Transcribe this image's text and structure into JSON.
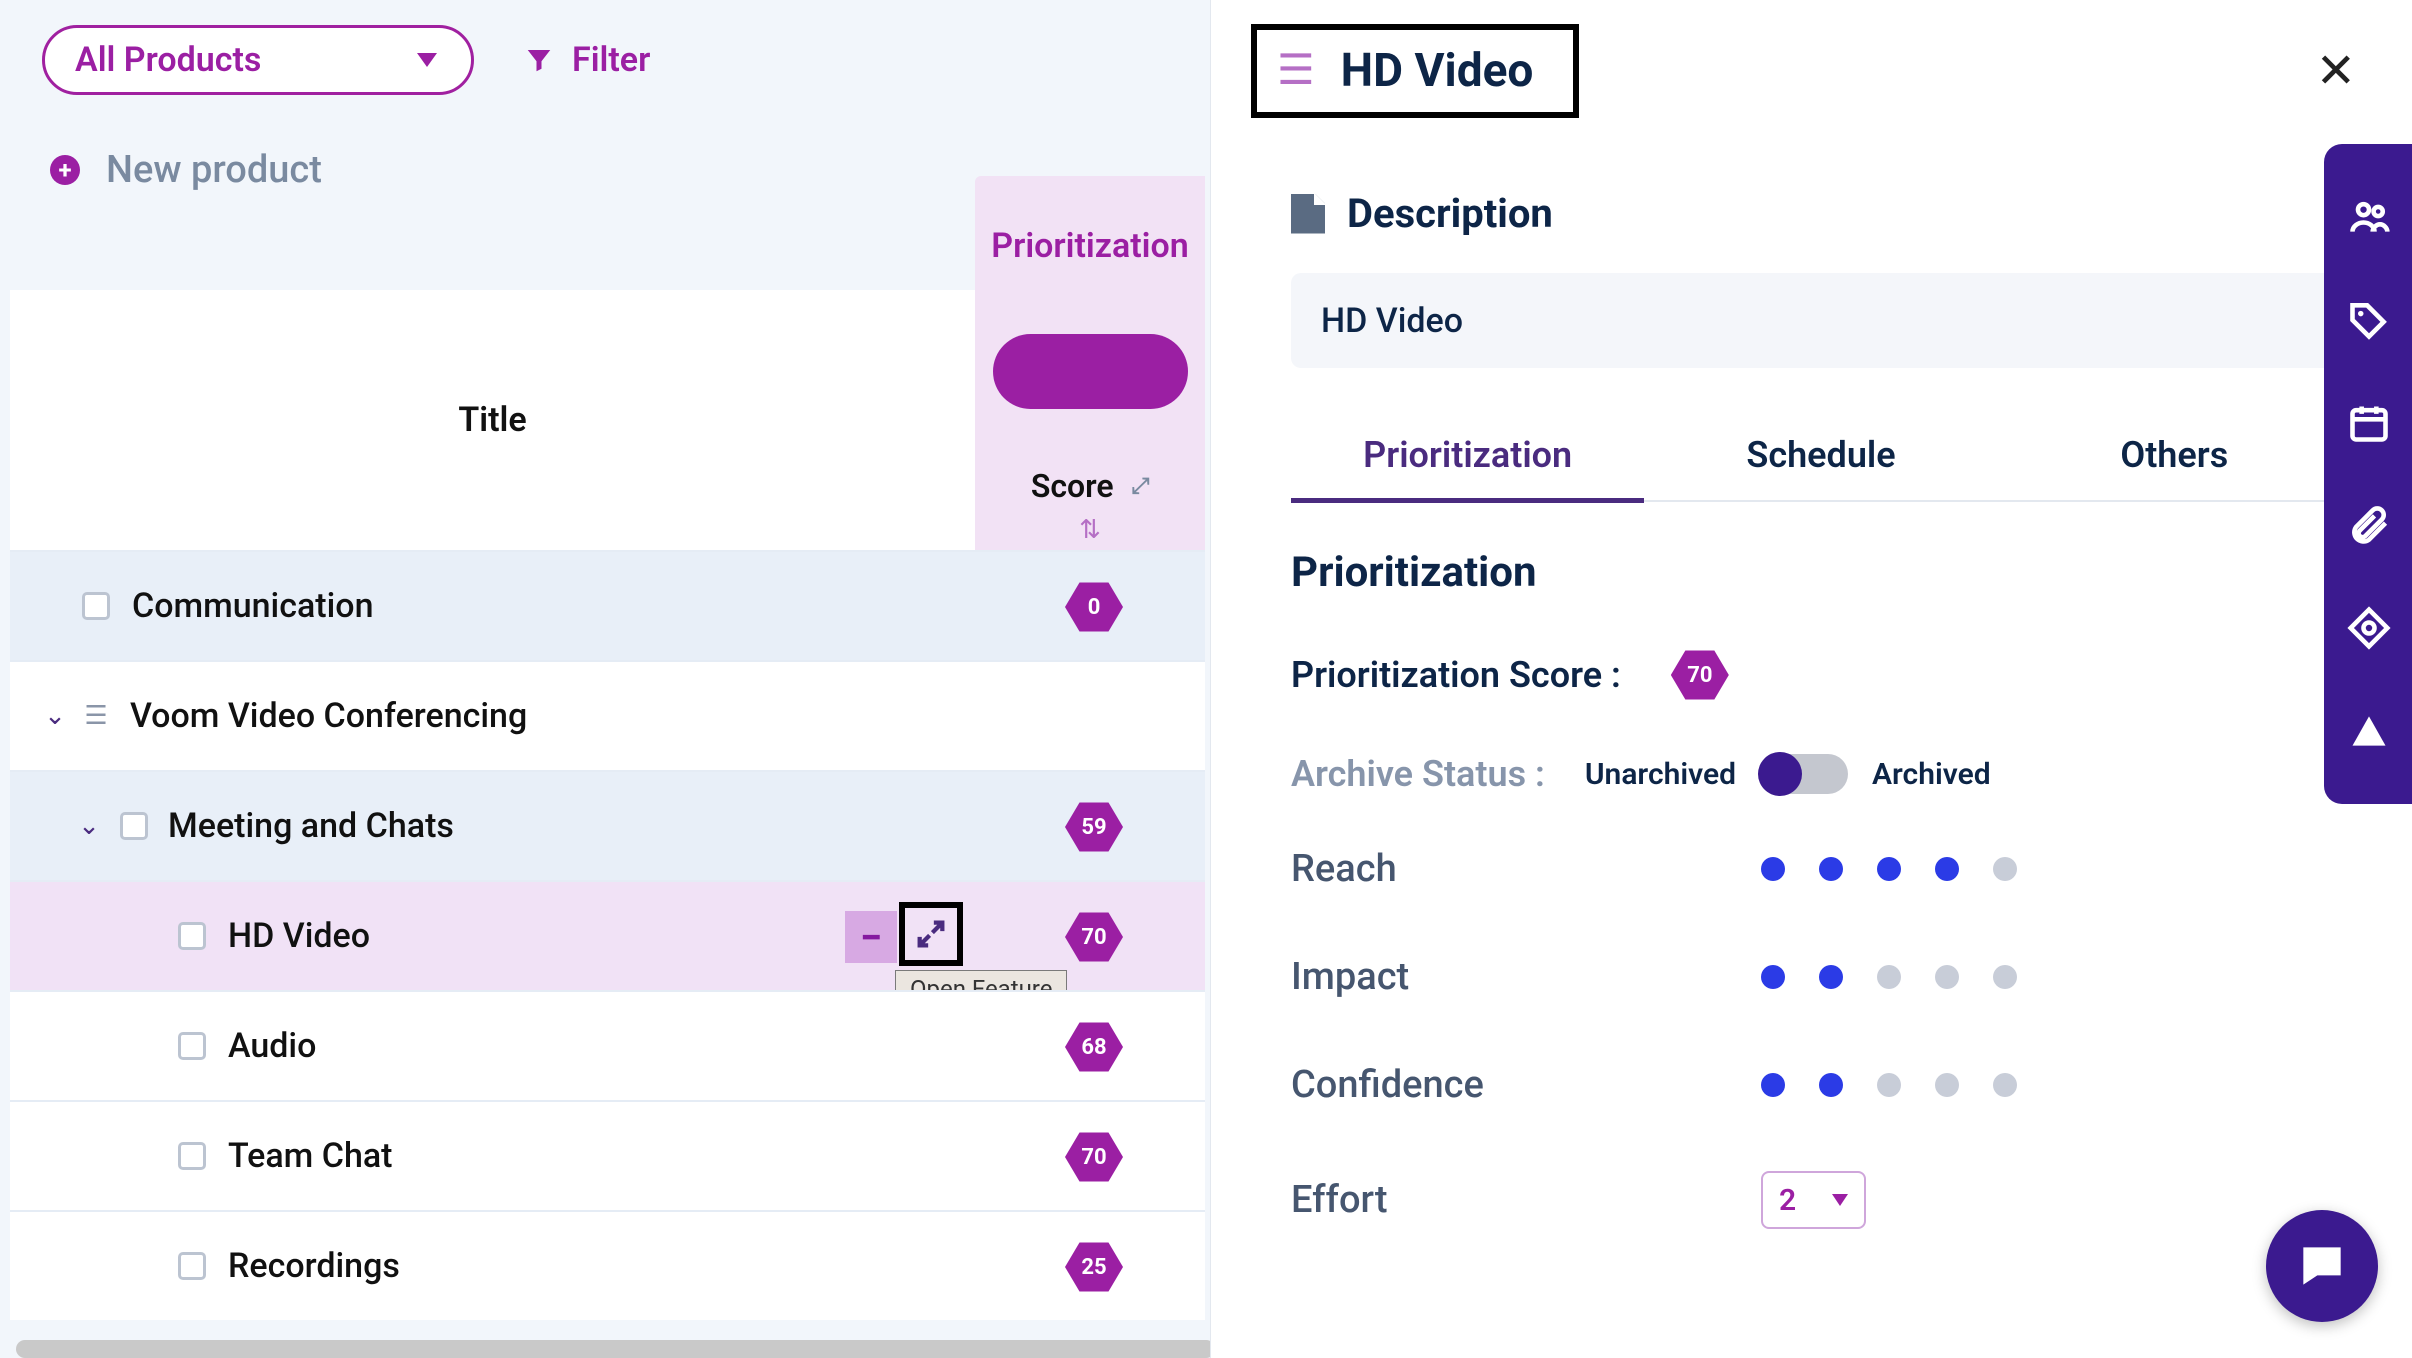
{
  "toolbar": {
    "products_dropdown_label": "All Products",
    "filter_label": "Filter"
  },
  "new_product_label": "New product",
  "columns": {
    "title": "Title",
    "prioritization_tab": "Prioritization",
    "score": "Score"
  },
  "rows": [
    {
      "type": "product",
      "title": "Communication",
      "score": "0"
    },
    {
      "type": "group",
      "title": "Voom Video Conferencing"
    },
    {
      "type": "subgroup",
      "title": "Meeting and Chats",
      "score": "59"
    },
    {
      "type": "feature",
      "title": "HD Video",
      "score": "70",
      "selected": true
    },
    {
      "type": "feature",
      "title": "Audio",
      "score": "68"
    },
    {
      "type": "feature",
      "title": "Team Chat",
      "score": "70"
    },
    {
      "type": "feature",
      "title": "Recordings",
      "score": "25"
    }
  ],
  "tooltip_open_feature": "Open Feature",
  "panel": {
    "title": "HD Video",
    "description_heading": "Description",
    "description_text": "HD Video",
    "tabs": {
      "prioritization": "Prioritization",
      "schedule": "Schedule",
      "others": "Others"
    },
    "prio_heading": "Prioritization",
    "score_label": "Prioritization Score :",
    "score_value": "70",
    "archive_label": "Archive Status :",
    "archive_left": "Unarchived",
    "archive_right": "Archived",
    "archive_state": "Unarchived",
    "metrics": {
      "reach": {
        "label": "Reach",
        "value": 4,
        "max": 5
      },
      "impact": {
        "label": "Impact",
        "value": 2,
        "max": 5
      },
      "confidence": {
        "label": "Confidence",
        "value": 2,
        "max": 5
      }
    },
    "effort": {
      "label": "Effort",
      "value": "2"
    }
  },
  "colors": {
    "brand_purple": "#9b1fa3",
    "deep_indigo": "#3b1a8f",
    "dot_active": "#2b3be6"
  }
}
